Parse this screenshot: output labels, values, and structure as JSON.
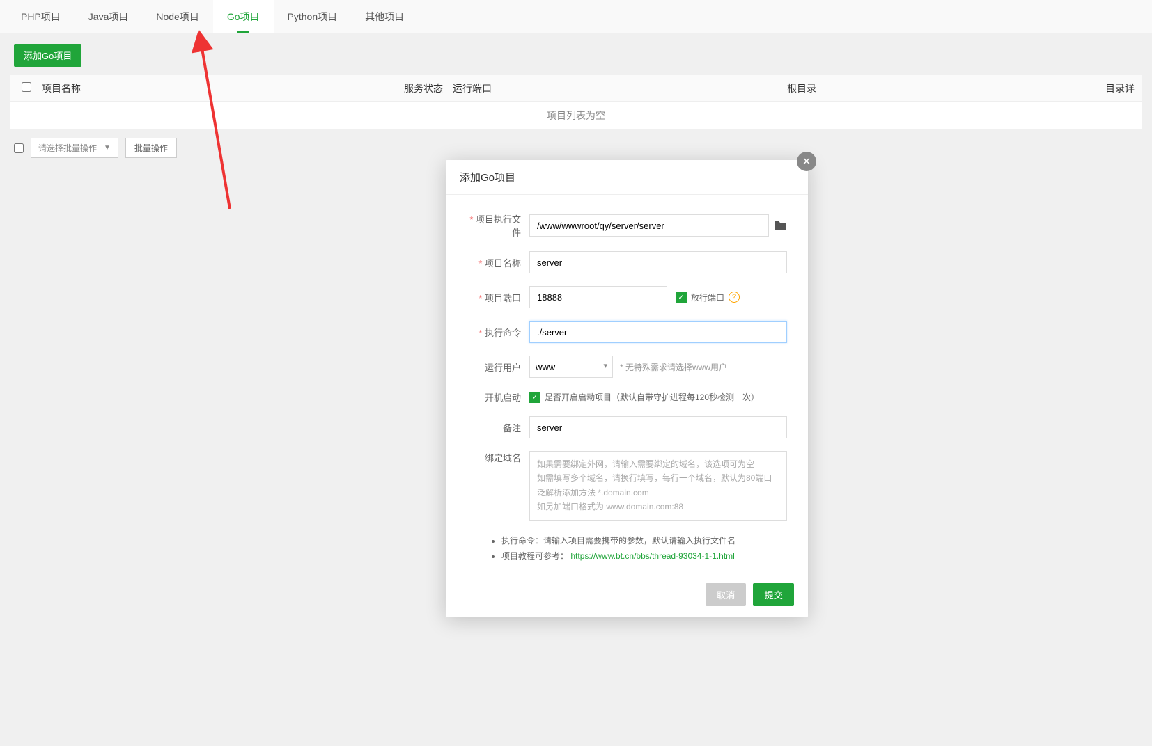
{
  "tabs": [
    {
      "label": "PHP项目",
      "active": false
    },
    {
      "label": "Java项目",
      "active": false
    },
    {
      "label": "Node项目",
      "active": false
    },
    {
      "label": "Go项目",
      "active": true
    },
    {
      "label": "Python项目",
      "active": false
    },
    {
      "label": "其他项目",
      "active": false
    }
  ],
  "toolbar": {
    "add_btn": "添加Go项目"
  },
  "table": {
    "headers": {
      "name": "项目名称",
      "status": "服务状态",
      "port": "运行端口",
      "rootdir": "根目录",
      "record": "目录详"
    },
    "empty": "项目列表为空"
  },
  "bulk": {
    "select_placeholder": "请选择批量操作",
    "do_btn": "批量操作"
  },
  "modal": {
    "title": "添加Go项目",
    "labels": {
      "exec_file": "项目执行文件",
      "name": "项目名称",
      "port": "项目端口",
      "cmd": "执行命令",
      "user": "运行用户",
      "autostart": "开机启动",
      "remark": "备注",
      "domain": "绑定域名"
    },
    "values": {
      "exec_file": "/www/wwwroot/qy/server/server",
      "name": "server",
      "port": "18888",
      "cmd": "./server",
      "user": "www",
      "remark": "server"
    },
    "port_checkbox_label": "放行端口",
    "user_hint": "* 无特殊需求请选择www用户",
    "autostart_text": "是否开启启动项目（默认自带守护进程每120秒检测一次）",
    "domain_placeholder": "如果需要绑定外网，请输入需要绑定的域名，该选项可为空\n如需填写多个域名，请换行填写，每行一个域名，默认为80端口\n泛解析添加方法 *.domain.com\n如另加端口格式为 www.domain.com:88",
    "tips": {
      "cmd": "执行命令：请输入项目需要携带的参数，默认请输入执行文件名",
      "tutorial_prefix": "项目教程可参考：",
      "tutorial_url": "https://www.bt.cn/bbs/thread-93034-1-1.html"
    },
    "buttons": {
      "cancel": "取消",
      "submit": "提交"
    }
  }
}
